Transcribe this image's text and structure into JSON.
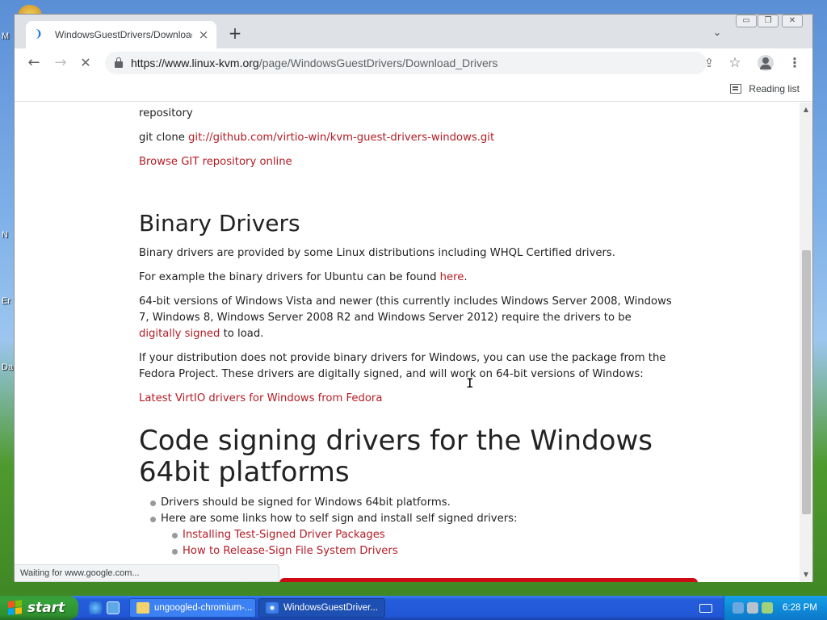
{
  "desktop": {
    "fragments": [
      "M",
      "N",
      "Er",
      "Da"
    ]
  },
  "window_controls": {
    "minimize": "▭",
    "restore": "❐",
    "close": "✕"
  },
  "tab": {
    "title": "WindowsGuestDrivers/Download Dri",
    "close_glyph": "×",
    "loading_glyph": "❩"
  },
  "tabbar": {
    "new_tab_glyph": "+",
    "tab_search_glyph": "⌄"
  },
  "toolbar": {
    "back_glyph": "←",
    "forward_glyph": "→",
    "stop_glyph": "✕",
    "url_host": "https://www.linux-kvm.org",
    "url_path": "/page/WindowsGuestDrivers/Download_Drivers",
    "share_glyph": "⇪",
    "bookmark_glyph": "☆",
    "menu_glyph": "⋮"
  },
  "bookmark_bar": {
    "reading_list_label": "Reading list"
  },
  "page": {
    "repo_line_tail": "repository",
    "git_clone_prefix": "git clone ",
    "git_clone_link": "git://github.com/virtio-win/kvm-guest-drivers-windows.git",
    "browse_git_link": "Browse GIT repository online",
    "binary_drivers_heading": "Binary Drivers",
    "binary_p1": "Binary drivers are provided by some Linux distributions including WHQL Certified drivers.",
    "binary_p2_text": "For example the binary drivers for Ubuntu can be found ",
    "binary_p2_link": "here",
    "binary_p2_end": ".",
    "binary_p3_text": "64-bit versions of Windows Vista and newer (this currently includes Windows Server 2008, Windows 7, Windows 8, Windows Server 2008 R2 and Windows Server 2012) require the drivers to be ",
    "binary_p3_link": "digitally signed",
    "binary_p3_end": " to load.",
    "binary_p4": "If your distribution does not provide binary drivers for Windows, you can use the package from the Fedora Project. These drivers are digitally signed, and will work on 64-bit versions of Windows:",
    "fedora_link": "Latest VirtIO drivers for Windows from Fedora",
    "code_signing_heading": "Code signing drivers for the Windows 64bit platforms",
    "bullets": [
      "Drivers should be signed for Windows 64bit platforms.",
      "Here are some links how to self sign and install self signed drivers:"
    ],
    "sub_links": [
      "Installing Test-Signed Driver Packages",
      "How to Release-Sign File System Drivers"
    ]
  },
  "status_bar": {
    "text": "Waiting for www.google.com..."
  },
  "taskbar": {
    "start_label": "start",
    "tasks": [
      {
        "label": "ungoogled-chromium-..."
      },
      {
        "label": "WindowsGuestDriver..."
      }
    ],
    "clock": "6:28 PM"
  },
  "colors": {
    "link": "#b41c25",
    "accent_bar": "#cc0b14",
    "taskbar": "#245edb",
    "start": "#36a33a"
  }
}
